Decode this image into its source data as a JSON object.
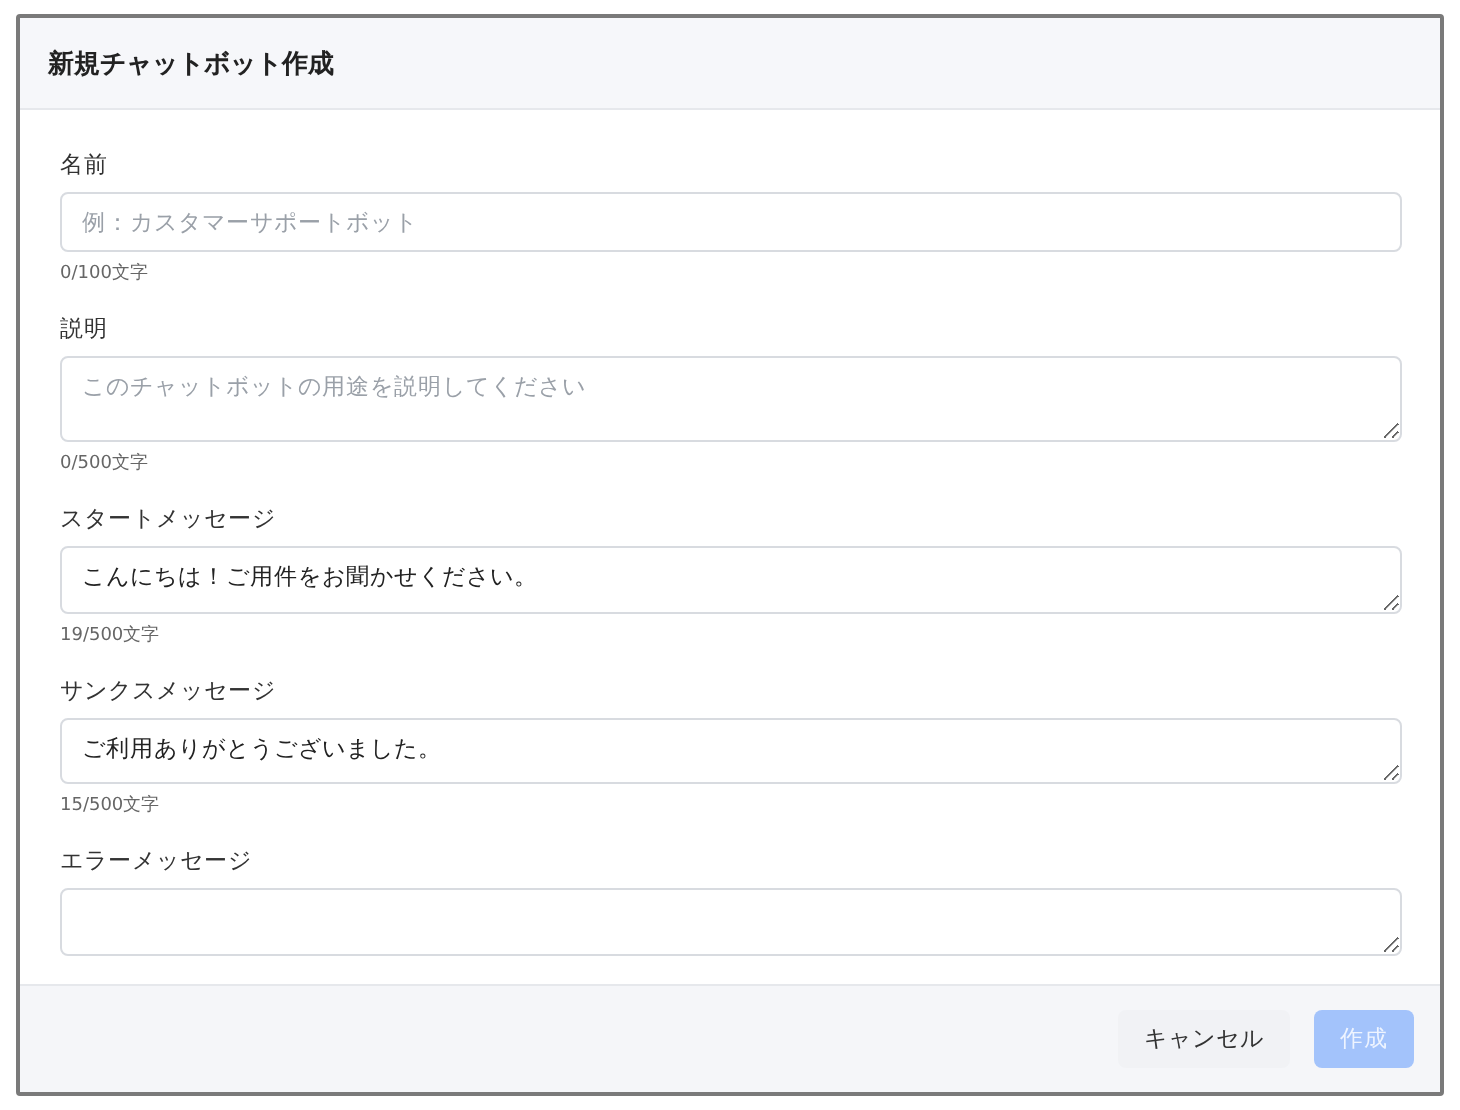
{
  "dialog": {
    "title": "新規チャットボット作成",
    "fields": [
      {
        "kind": "input",
        "label": "名前",
        "placeholder": "例：カスタマーサポートボット",
        "counter": "0/100文字"
      },
      {
        "kind": "textarea",
        "label": "説明",
        "placeholder": "このチャットボットの用途を説明してください",
        "counter": "0/500文字"
      },
      {
        "kind": "textarea",
        "label": "スタートメッセージ",
        "value": "こんにちは！ご用件をお聞かせください。",
        "counter": "19/500文字"
      },
      {
        "kind": "textarea",
        "label": "サンクスメッセージ",
        "value": "ご利用ありがとうございました。",
        "counter": "15/500文字"
      },
      {
        "kind": "textarea",
        "label": "エラーメッセージ"
      }
    ],
    "buttons": [
      {
        "label": "キャンセル",
        "kind": "secondary",
        "disabled": false
      },
      {
        "label": "作成",
        "kind": "primary",
        "disabled": true
      }
    ]
  }
}
